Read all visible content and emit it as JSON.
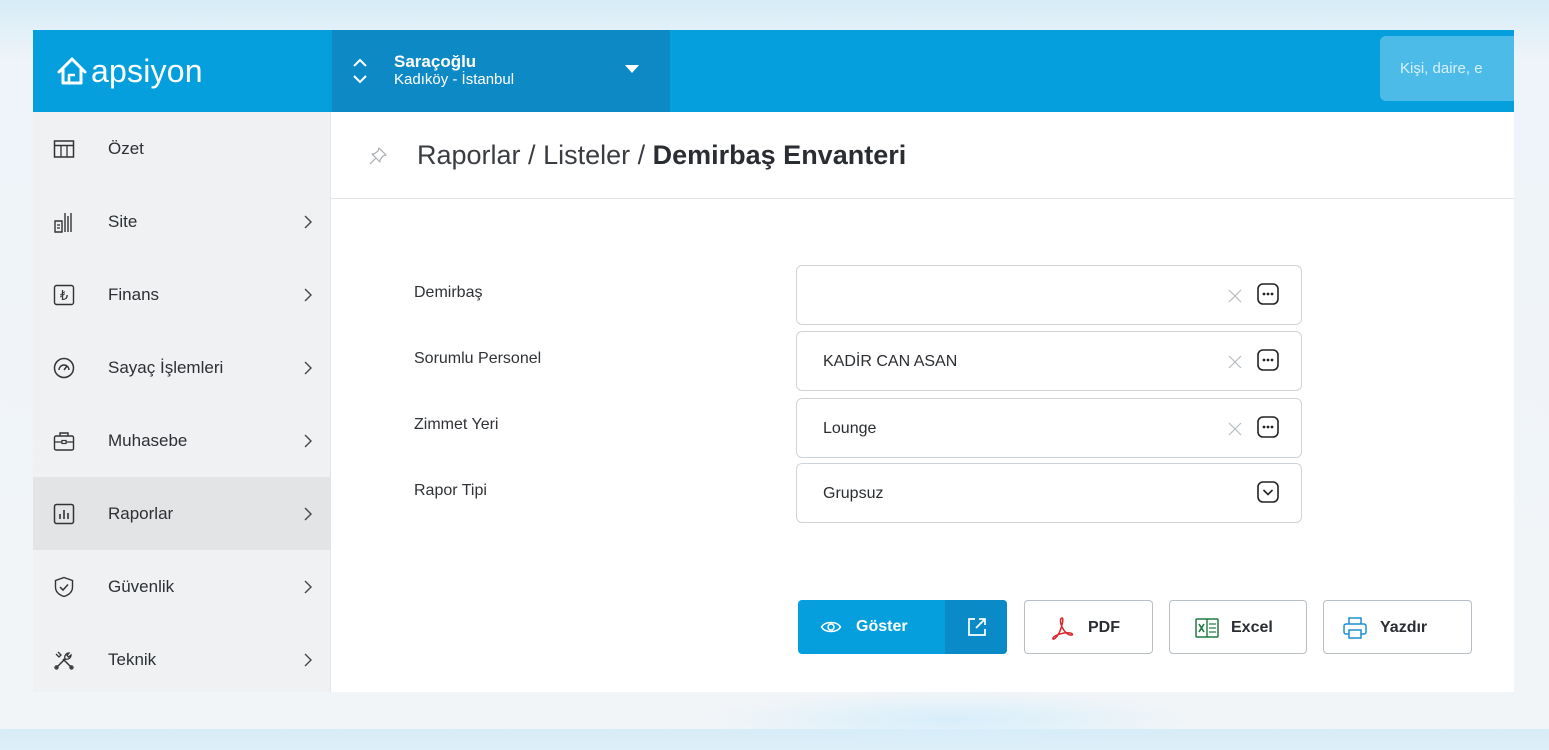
{
  "brand": {
    "logo_text": "apsiyon"
  },
  "site_selector": {
    "name": "Saraçoğlu",
    "location": "Kadıköy - İstanbul"
  },
  "search": {
    "placeholder": "Kişi, daire, e"
  },
  "sidebar": {
    "items": [
      {
        "label": "Özet",
        "icon": "grid-table-icon",
        "has_arrow": false
      },
      {
        "label": "Site",
        "icon": "building-icon",
        "has_arrow": true
      },
      {
        "label": "Finans",
        "icon": "lira-icon",
        "has_arrow": true
      },
      {
        "label": "Sayaç İşlemleri",
        "icon": "gauge-icon",
        "has_arrow": true
      },
      {
        "label": "Muhasebe",
        "icon": "briefcase-icon",
        "has_arrow": true
      },
      {
        "label": "Raporlar",
        "icon": "bar-chart-icon",
        "has_arrow": true,
        "active": true
      },
      {
        "label": "Güvenlik",
        "icon": "shield-check-icon",
        "has_arrow": true
      },
      {
        "label": "Teknik",
        "icon": "tools-icon",
        "has_arrow": true
      }
    ]
  },
  "breadcrumb": {
    "part1": "Raporlar",
    "sep": " / ",
    "part2": "Listeler",
    "current": "Demirbaş Envanteri"
  },
  "form": {
    "fields": [
      {
        "label": "Demirbaş",
        "value": "",
        "control": "lookup"
      },
      {
        "label": "Sorumlu Personel",
        "value": "KADİR CAN ASAN",
        "control": "lookup"
      },
      {
        "label": "Zimmet Yeri",
        "value": "Lounge",
        "control": "lookup"
      },
      {
        "label": "Rapor Tipi",
        "value": "Grupsuz",
        "control": "select"
      }
    ]
  },
  "actions": {
    "show": "Göster",
    "pdf": "PDF",
    "excel": "Excel",
    "print": "Yazdır"
  },
  "colors": {
    "primary": "#069fdd",
    "primary_dark": "#0d8ac6",
    "pdf_red": "#d9252b",
    "excel_green": "#1e7a42"
  }
}
